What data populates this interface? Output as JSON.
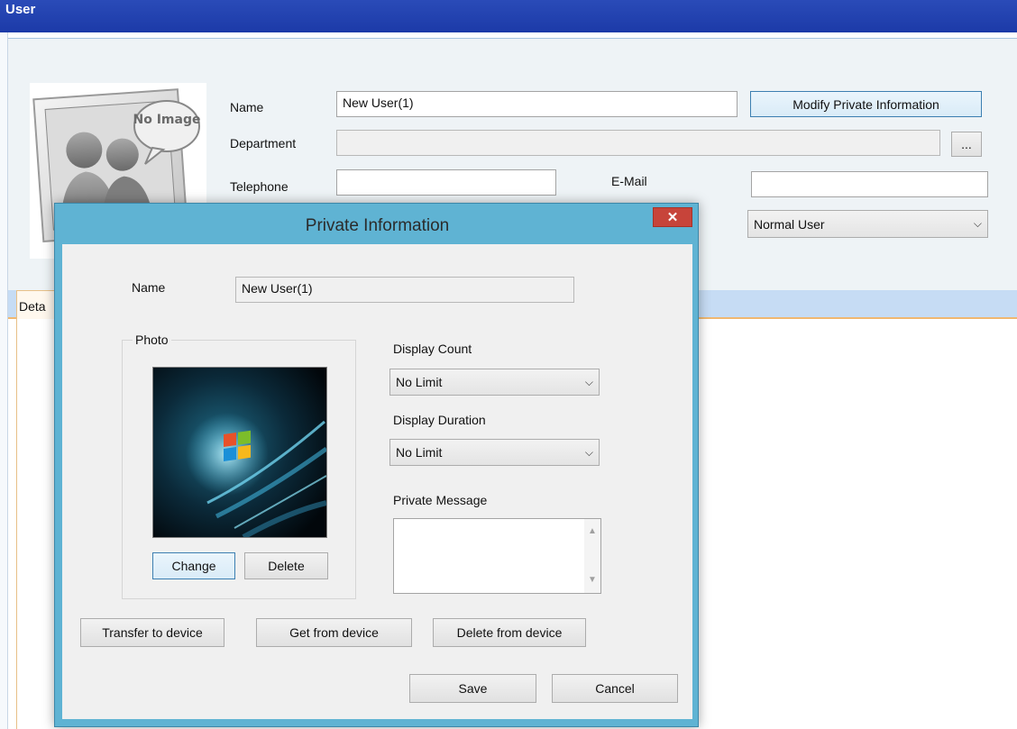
{
  "window": {
    "title": "User"
  },
  "user_form": {
    "photo_placeholder": "No Image",
    "name_label": "Name",
    "name_value": "New User(1)",
    "modify_button": "Modify Private Information",
    "department_label": "Department",
    "department_value": "",
    "browse_button": "...",
    "telephone_label": "Telephone",
    "telephone_value": "",
    "email_label": "E-Mail",
    "email_value": "",
    "user_type_value": "Normal User",
    "detail_tab_label": "Deta"
  },
  "dialog": {
    "title": "Private Information",
    "close_glyph": "✕",
    "name_label": "Name",
    "name_value": "New User(1)",
    "photo_group_label": "Photo",
    "change_button": "Change",
    "delete_button": "Delete",
    "display_count_label": "Display Count",
    "display_count_value": "No Limit",
    "display_duration_label": "Display Duration",
    "display_duration_value": "No Limit",
    "private_message_label": "Private Message",
    "private_message_value": "",
    "transfer_button": "Transfer to device",
    "get_button": "Get from device",
    "delete_device_button": "Delete from device",
    "save_button": "Save",
    "cancel_button": "Cancel"
  },
  "icons": {
    "dropdown": "chevron-down-icon",
    "close": "close-icon",
    "placeholder_photo": "no-image-icon",
    "windows_logo": "windows-logo-icon"
  }
}
